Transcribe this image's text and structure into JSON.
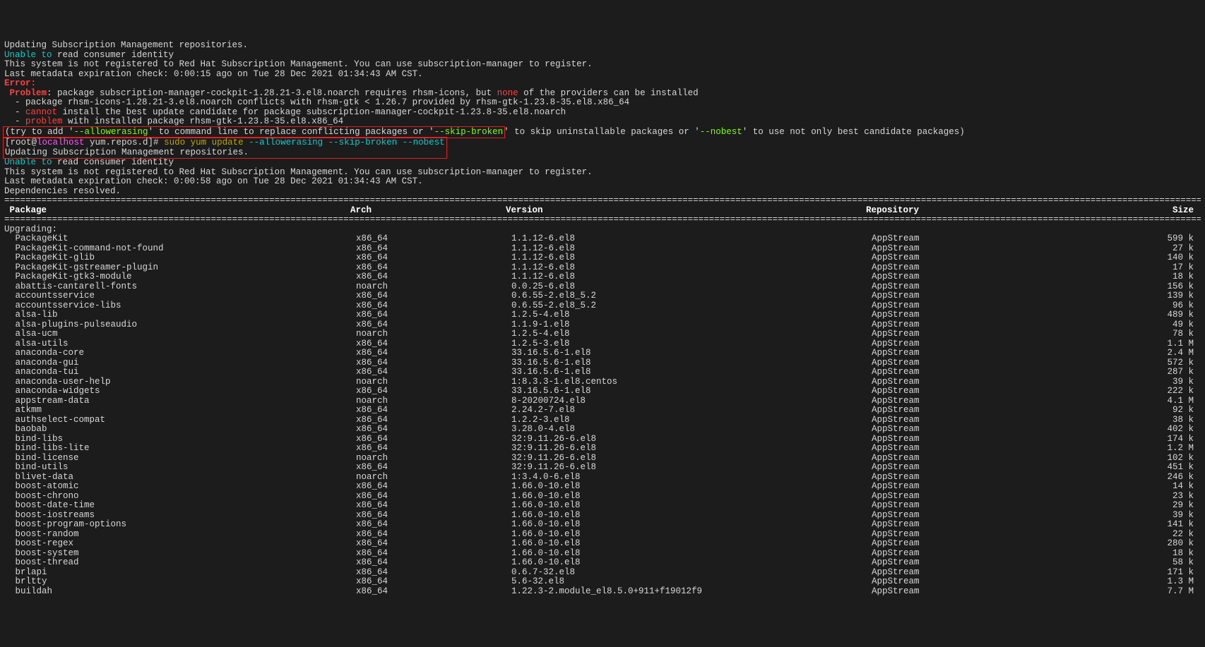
{
  "pre": {
    "l1": "Updating Subscription Management repositories.",
    "l2a": "Unable to",
    "l2b": " read consumer identity",
    "l3": "This system is not registered to Red Hat Subscription Management. You can use subscription-manager to register.",
    "l4": "Last metadata expiration check: 0:00:15 ago on Tue 28 Dec 2021 01:34:43 AM CST.",
    "err": "Error: ",
    "prob": " Problem",
    "prob_rest": ": package subscription-manager-cockpit-1.28.21-3.el8.noarch requires rhsm-icons, but ",
    "none": "none",
    "prob_rest2": " of the providers can be installed",
    "p2": "  - package rhsm-icons-1.28.21-3.el8.noarch conflicts with rhsm-gtk < 1.26.7 provided by rhsm-gtk-1.23.8-35.el8.x86_64",
    "p3a": "  - ",
    "cannot": "cannot",
    "p3b": " install the best update candidate for package subscription-manager-cockpit-1.23.8-35.el8.noarch",
    "p4a": "  - ",
    "problem": "problem",
    "p4b": " with installed package rhsm-gtk-1.23.8-35.el8.x86_64",
    "try1": "(try to add '",
    "opt1": "--allowerasing",
    "try2": "' to command line to replace conflicting packages or '",
    "opt2": "--skip-broken",
    "try3": "' to skip uninstallable packages or '",
    "opt3": "--nobest",
    "try4": "' to use not only best candidate packages)"
  },
  "prompt": {
    "open": "[root@",
    "host": "localhost",
    "path": " yum.repos.d",
    "close": "]# ",
    "cmd": "sudo yum update ",
    "args": "--allowerasing --skip-broken --nobest"
  },
  "post": {
    "l1": "Updating Subscription Management repositories.",
    "l2a": "Unable to",
    "l2b": " read consumer identity",
    "l3": "This system is not registered to Red Hat Subscription Management. You can use subscription-manager to register.",
    "l4": "Last metadata expiration check: 0:00:58 ago on Tue 28 Dec 2021 01:34:43 AM CST.",
    "l5": "Dependencies resolved."
  },
  "divider": "==================================================================================================================================================================================================================================================",
  "headers": {
    "pkg": " Package",
    "arch": "Arch",
    "ver": "Version",
    "repo": "Repository",
    "size": "Size"
  },
  "upgrading": "Upgrading:",
  "rows": [
    {
      "pkg": "PackageKit",
      "arch": "x86_64",
      "ver": "1.1.12-6.el8",
      "repo": "AppStream",
      "size": "599 k"
    },
    {
      "pkg": "PackageKit-command-not-found",
      "arch": "x86_64",
      "ver": "1.1.12-6.el8",
      "repo": "AppStream",
      "size": "27 k"
    },
    {
      "pkg": "PackageKit-glib",
      "arch": "x86_64",
      "ver": "1.1.12-6.el8",
      "repo": "AppStream",
      "size": "140 k"
    },
    {
      "pkg": "PackageKit-gstreamer-plugin",
      "arch": "x86_64",
      "ver": "1.1.12-6.el8",
      "repo": "AppStream",
      "size": "17 k"
    },
    {
      "pkg": "PackageKit-gtk3-module",
      "arch": "x86_64",
      "ver": "1.1.12-6.el8",
      "repo": "AppStream",
      "size": "18 k"
    },
    {
      "pkg": "abattis-cantarell-fonts",
      "arch": "noarch",
      "ver": "0.0.25-6.el8",
      "repo": "AppStream",
      "size": "156 k"
    },
    {
      "pkg": "accountsservice",
      "arch": "x86_64",
      "ver": "0.6.55-2.el8_5.2",
      "repo": "AppStream",
      "size": "139 k"
    },
    {
      "pkg": "accountsservice-libs",
      "arch": "x86_64",
      "ver": "0.6.55-2.el8_5.2",
      "repo": "AppStream",
      "size": "96 k"
    },
    {
      "pkg": "alsa-lib",
      "arch": "x86_64",
      "ver": "1.2.5-4.el8",
      "repo": "AppStream",
      "size": "489 k"
    },
    {
      "pkg": "alsa-plugins-pulseaudio",
      "arch": "x86_64",
      "ver": "1.1.9-1.el8",
      "repo": "AppStream",
      "size": "49 k"
    },
    {
      "pkg": "alsa-ucm",
      "arch": "noarch",
      "ver": "1.2.5-4.el8",
      "repo": "AppStream",
      "size": "78 k"
    },
    {
      "pkg": "alsa-utils",
      "arch": "x86_64",
      "ver": "1.2.5-3.el8",
      "repo": "AppStream",
      "size": "1.1 M"
    },
    {
      "pkg": "anaconda-core",
      "arch": "x86_64",
      "ver": "33.16.5.6-1.el8",
      "repo": "AppStream",
      "size": "2.4 M"
    },
    {
      "pkg": "anaconda-gui",
      "arch": "x86_64",
      "ver": "33.16.5.6-1.el8",
      "repo": "AppStream",
      "size": "572 k"
    },
    {
      "pkg": "anaconda-tui",
      "arch": "x86_64",
      "ver": "33.16.5.6-1.el8",
      "repo": "AppStream",
      "size": "287 k"
    },
    {
      "pkg": "anaconda-user-help",
      "arch": "noarch",
      "ver": "1:8.3.3-1.el8.centos",
      "repo": "AppStream",
      "size": "39 k"
    },
    {
      "pkg": "anaconda-widgets",
      "arch": "x86_64",
      "ver": "33.16.5.6-1.el8",
      "repo": "AppStream",
      "size": "222 k"
    },
    {
      "pkg": "appstream-data",
      "arch": "noarch",
      "ver": "8-20200724.el8",
      "repo": "AppStream",
      "size": "4.1 M"
    },
    {
      "pkg": "atkmm",
      "arch": "x86_64",
      "ver": "2.24.2-7.el8",
      "repo": "AppStream",
      "size": "92 k"
    },
    {
      "pkg": "authselect-compat",
      "arch": "x86_64",
      "ver": "1.2.2-3.el8",
      "repo": "AppStream",
      "size": "38 k"
    },
    {
      "pkg": "baobab",
      "arch": "x86_64",
      "ver": "3.28.0-4.el8",
      "repo": "AppStream",
      "size": "402 k"
    },
    {
      "pkg": "bind-libs",
      "arch": "x86_64",
      "ver": "32:9.11.26-6.el8",
      "repo": "AppStream",
      "size": "174 k"
    },
    {
      "pkg": "bind-libs-lite",
      "arch": "x86_64",
      "ver": "32:9.11.26-6.el8",
      "repo": "AppStream",
      "size": "1.2 M"
    },
    {
      "pkg": "bind-license",
      "arch": "noarch",
      "ver": "32:9.11.26-6.el8",
      "repo": "AppStream",
      "size": "102 k"
    },
    {
      "pkg": "bind-utils",
      "arch": "x86_64",
      "ver": "32:9.11.26-6.el8",
      "repo": "AppStream",
      "size": "451 k"
    },
    {
      "pkg": "blivet-data",
      "arch": "noarch",
      "ver": "1:3.4.0-6.el8",
      "repo": "AppStream",
      "size": "246 k"
    },
    {
      "pkg": "boost-atomic",
      "arch": "x86_64",
      "ver": "1.66.0-10.el8",
      "repo": "AppStream",
      "size": "14 k"
    },
    {
      "pkg": "boost-chrono",
      "arch": "x86_64",
      "ver": "1.66.0-10.el8",
      "repo": "AppStream",
      "size": "23 k"
    },
    {
      "pkg": "boost-date-time",
      "arch": "x86_64",
      "ver": "1.66.0-10.el8",
      "repo": "AppStream",
      "size": "29 k"
    },
    {
      "pkg": "boost-iostreams",
      "arch": "x86_64",
      "ver": "1.66.0-10.el8",
      "repo": "AppStream",
      "size": "39 k"
    },
    {
      "pkg": "boost-program-options",
      "arch": "x86_64",
      "ver": "1.66.0-10.el8",
      "repo": "AppStream",
      "size": "141 k"
    },
    {
      "pkg": "boost-random",
      "arch": "x86_64",
      "ver": "1.66.0-10.el8",
      "repo": "AppStream",
      "size": "22 k"
    },
    {
      "pkg": "boost-regex",
      "arch": "x86_64",
      "ver": "1.66.0-10.el8",
      "repo": "AppStream",
      "size": "280 k"
    },
    {
      "pkg": "boost-system",
      "arch": "x86_64",
      "ver": "1.66.0-10.el8",
      "repo": "AppStream",
      "size": "18 k"
    },
    {
      "pkg": "boost-thread",
      "arch": "x86_64",
      "ver": "1.66.0-10.el8",
      "repo": "AppStream",
      "size": "58 k"
    },
    {
      "pkg": "brlapi",
      "arch": "x86_64",
      "ver": "0.6.7-32.el8",
      "repo": "AppStream",
      "size": "171 k"
    },
    {
      "pkg": "brltty",
      "arch": "x86_64",
      "ver": "5.6-32.el8",
      "repo": "AppStream",
      "size": "1.3 M"
    },
    {
      "pkg": "buildah",
      "arch": "x86_64",
      "ver": "1.22.3-2.module_el8.5.0+911+f19012f9",
      "repo": "AppStream",
      "size": "7.7 M"
    }
  ]
}
